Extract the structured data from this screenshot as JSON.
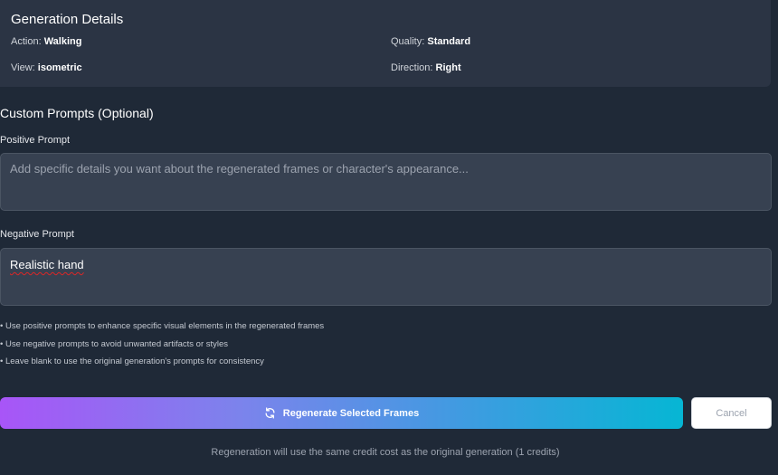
{
  "generation_details": {
    "title": "Generation Details",
    "action_label": "Action:",
    "action_value": "Walking",
    "quality_label": "Quality:",
    "quality_value": "Standard",
    "view_label": "View:",
    "view_value": "isometric",
    "direction_label": "Direction:",
    "direction_value": "Right"
  },
  "custom_prompts": {
    "title": "Custom Prompts (Optional)",
    "positive_label": "Positive Prompt",
    "positive_placeholder": "Add specific details you want about the regenerated frames or character's appearance...",
    "positive_value": "",
    "negative_label": "Negative Prompt",
    "negative_value": "Realistic hand"
  },
  "hints": [
    "• Use positive prompts to enhance specific visual elements in the regenerated frames",
    "• Use negative prompts to avoid unwanted artifacts or styles",
    "• Leave blank to use the original generation's prompts for consistency"
  ],
  "actions": {
    "regenerate_label": "Regenerate Selected Frames",
    "regenerate_icon": "refresh-icon",
    "cancel_label": "Cancel"
  },
  "footnote": "Regeneration will use the same credit cost as the original generation (1 credits)"
}
